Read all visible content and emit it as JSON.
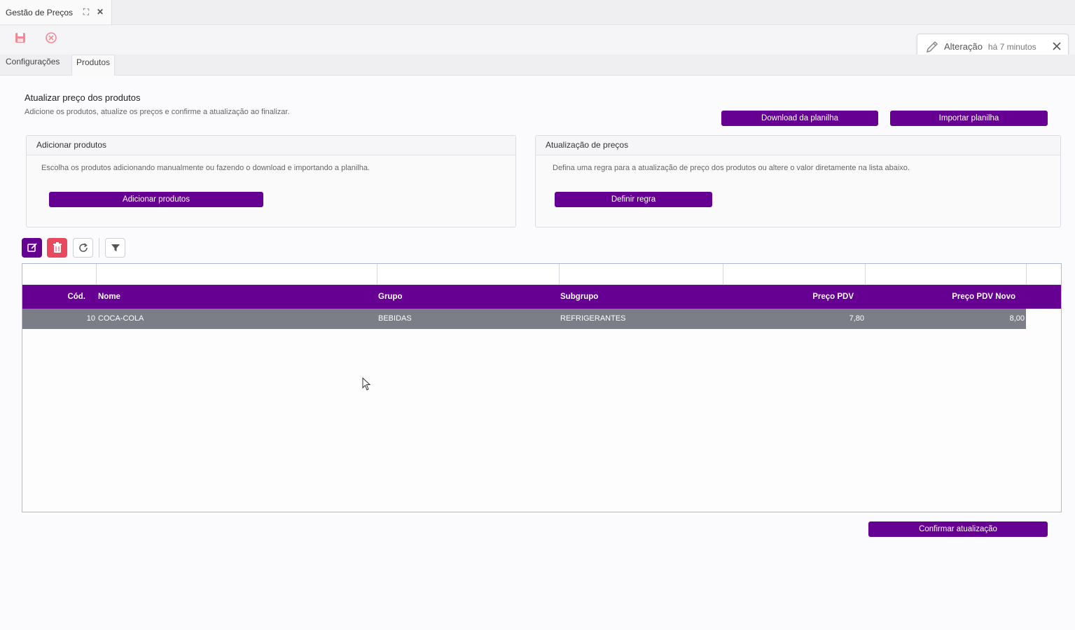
{
  "window": {
    "title": "Gestão de Preços",
    "maximize_icon": "maximize-icon",
    "close_icon": "close-icon"
  },
  "toolbar": {
    "save_icon": "save-icon",
    "cancel_icon": "cancel-circle-icon"
  },
  "notification": {
    "title": "Alteração",
    "time": "há 7 minutos"
  },
  "tabs": [
    {
      "label": "Configurações",
      "active": false
    },
    {
      "label": "Produtos",
      "active": true
    }
  ],
  "header": {
    "title": "Atualizar preço dos produtos",
    "subtitle": "Adicione os produtos, atualize os preços e confirme a atualização ao finalizar.",
    "download_label": "Download da planilha",
    "import_label": "Importar planilha"
  },
  "panel_add": {
    "title": "Adicionar produtos",
    "text": "Escolha os produtos adicionando manualmente ou fazendo o download e importando a planilha.",
    "button_label": "Adicionar produtos"
  },
  "panel_rule": {
    "title": "Atualização de preços",
    "text": "Defina uma regra para a atualização de preço dos produtos ou altere o valor diretamente na lista abaixo.",
    "button_label": "Definir regra"
  },
  "grid": {
    "columns": [
      "Cód.",
      "Nome",
      "Grupo",
      "Subgrupo",
      "Preço PDV",
      "Preço PDV Novo"
    ],
    "rows": [
      {
        "cod": "10",
        "nome": "COCA-COLA",
        "grupo": "BEBIDAS",
        "subgrupo": "REFRIGERANTES",
        "preco": "7,80",
        "preco_novo": "8,00"
      }
    ]
  },
  "footer": {
    "confirm_label": "Confirmar atualização"
  },
  "colors": {
    "primary": "#660092",
    "danger": "#e8495f",
    "selected_row": "#7b7e86"
  }
}
